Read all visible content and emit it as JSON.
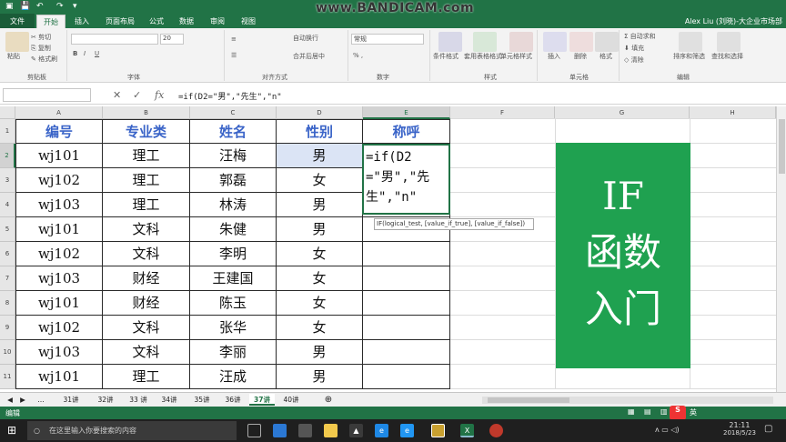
{
  "watermark": "www.BANDICAM.com",
  "user": "Alex Liu (刘晓)-大企业市场部",
  "ribbon_tabs": [
    "文件",
    "开始",
    "插入",
    "页面布局",
    "公式",
    "数据",
    "审阅",
    "视图"
  ],
  "clipboard": {
    "paste": "粘贴",
    "cut": "剪切",
    "copy": "复制",
    "format_painter": "格式刷",
    "label": "剪贴板"
  },
  "font": {
    "size": "20",
    "label": "字体"
  },
  "alignment": {
    "wrap": "自动换行",
    "merge": "合并后居中",
    "label": "对齐方式"
  },
  "number": {
    "format": "常规",
    "label": "数字"
  },
  "styles": {
    "cond": "条件格式",
    "table": "套用表格格式",
    "cell": "单元格样式",
    "label": "样式"
  },
  "cells": {
    "insert": "插入",
    "delete": "删除",
    "format": "格式",
    "label": "单元格"
  },
  "editing": {
    "autosum": "自动求和",
    "fill": "填充",
    "clear": "清除",
    "sort": "排序和筛选",
    "find": "查找和选择",
    "label": "编辑"
  },
  "formula_bar": {
    "fx": "fx",
    "content": "=if(D2=\"男\",\"先生\",\"n\""
  },
  "columns": [
    "A",
    "B",
    "C",
    "D",
    "E",
    "F",
    "G",
    "H"
  ],
  "rows": [
    "1",
    "2",
    "3",
    "4",
    "5",
    "6",
    "7",
    "8",
    "9",
    "10",
    "11"
  ],
  "table": {
    "headers": [
      "编号",
      "专业类",
      "姓名",
      "性别",
      "称呼"
    ],
    "data": [
      [
        "wj101",
        "理工",
        "汪梅",
        "男"
      ],
      [
        "wj102",
        "理工",
        "郭磊",
        "女"
      ],
      [
        "wj103",
        "理工",
        "林涛",
        "男"
      ],
      [
        "wj101",
        "文科",
        "朱健",
        "男"
      ],
      [
        "wj102",
        "文科",
        "李明",
        "女"
      ],
      [
        "wj103",
        "财经",
        "王建国",
        "女"
      ],
      [
        "wj101",
        "财经",
        "陈玉",
        "女"
      ],
      [
        "wj102",
        "文科",
        "张华",
        "女"
      ],
      [
        "wj103",
        "文科",
        "李丽",
        "男"
      ],
      [
        "wj101",
        "理工",
        "汪成",
        "男"
      ]
    ]
  },
  "editing_cell": "=if(D2=\"男\",\"先生\",\"n\"",
  "tooltip": "IF(logical_test, [value_if_true], [value_if_false])",
  "green_box": [
    "IF",
    "函数",
    "入门"
  ],
  "sheets": [
    "31讲",
    "32讲",
    "33 讲",
    "34讲",
    "35讲",
    "36讲",
    "37讲",
    "40讲"
  ],
  "active_sheet": "37讲",
  "status": {
    "mode": "编辑"
  },
  "taskbar": {
    "search": "在这里输入你要搜索的内容",
    "time": "21:11",
    "date": "2018/5/23",
    "ime": "英"
  }
}
